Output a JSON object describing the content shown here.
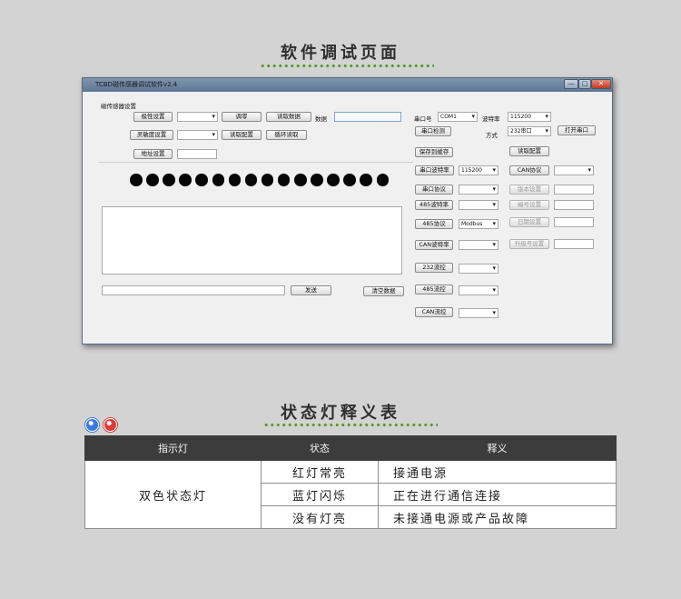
{
  "section1": {
    "title": "软件调试页面"
  },
  "section2": {
    "title": "状态灯释义表"
  },
  "window": {
    "title": "TCBD磁传感器调试软件v2.4",
    "min": "—",
    "max": "□",
    "close": "✕"
  },
  "left": {
    "group_label": "磁传感器设置",
    "btn_polarity": "极性设置",
    "btn_zero": "调零",
    "btn_read_data": "读取数据",
    "data_label": "数据",
    "btn_sensitivity": "灵敏度设置",
    "btn_read_config": "读取配置",
    "btn_loop_read": "循环读取",
    "btn_address": "地址设置",
    "btn_send": "发送",
    "btn_clear": "清空数据"
  },
  "right": {
    "port_label": "串口号",
    "port_value": "COM1",
    "baud_label": "波特率",
    "baud_value": "115200",
    "btn_port_detect": "串口检测",
    "mode_label": "方式",
    "mode_value": "232串口",
    "btn_open_port": "打开串口",
    "btn_save_cache": "保存到缓存",
    "btn_read_config": "读取配置",
    "btn_serial_baud": "串口波特率",
    "serial_baud_value": "115200",
    "btn_can_protocol": "CAN协议",
    "btn_serial_protocol": "串口协议",
    "btn_version": "版本设置",
    "btn_485_baud": "485波特率",
    "btn_number": "编号设置",
    "btn_485_protocol": "485协议",
    "protocol_485_value": "Modbus",
    "btn_date": "日期设置",
    "btn_can_baud": "CAN波特率",
    "btn_upgrade": "升级号设置",
    "btn_232_flow": "232流控",
    "btn_485_flow": "485流控",
    "btn_can_flow": "CAN流控"
  },
  "leds": {
    "count": 16,
    "color": "#070707"
  },
  "indicators": {
    "blue": "#3a78e0",
    "red": "#e03a3a"
  },
  "table": {
    "headers": [
      "指示灯",
      "状态",
      "释义"
    ],
    "indicator": "双色状态灯",
    "rows": [
      {
        "state": "红灯常亮",
        "meaning": "接通电源"
      },
      {
        "state": "蓝灯闪烁",
        "meaning": "正在进行通信连接"
      },
      {
        "state": "没有灯亮",
        "meaning": "未接通电源或产品故障"
      }
    ]
  }
}
